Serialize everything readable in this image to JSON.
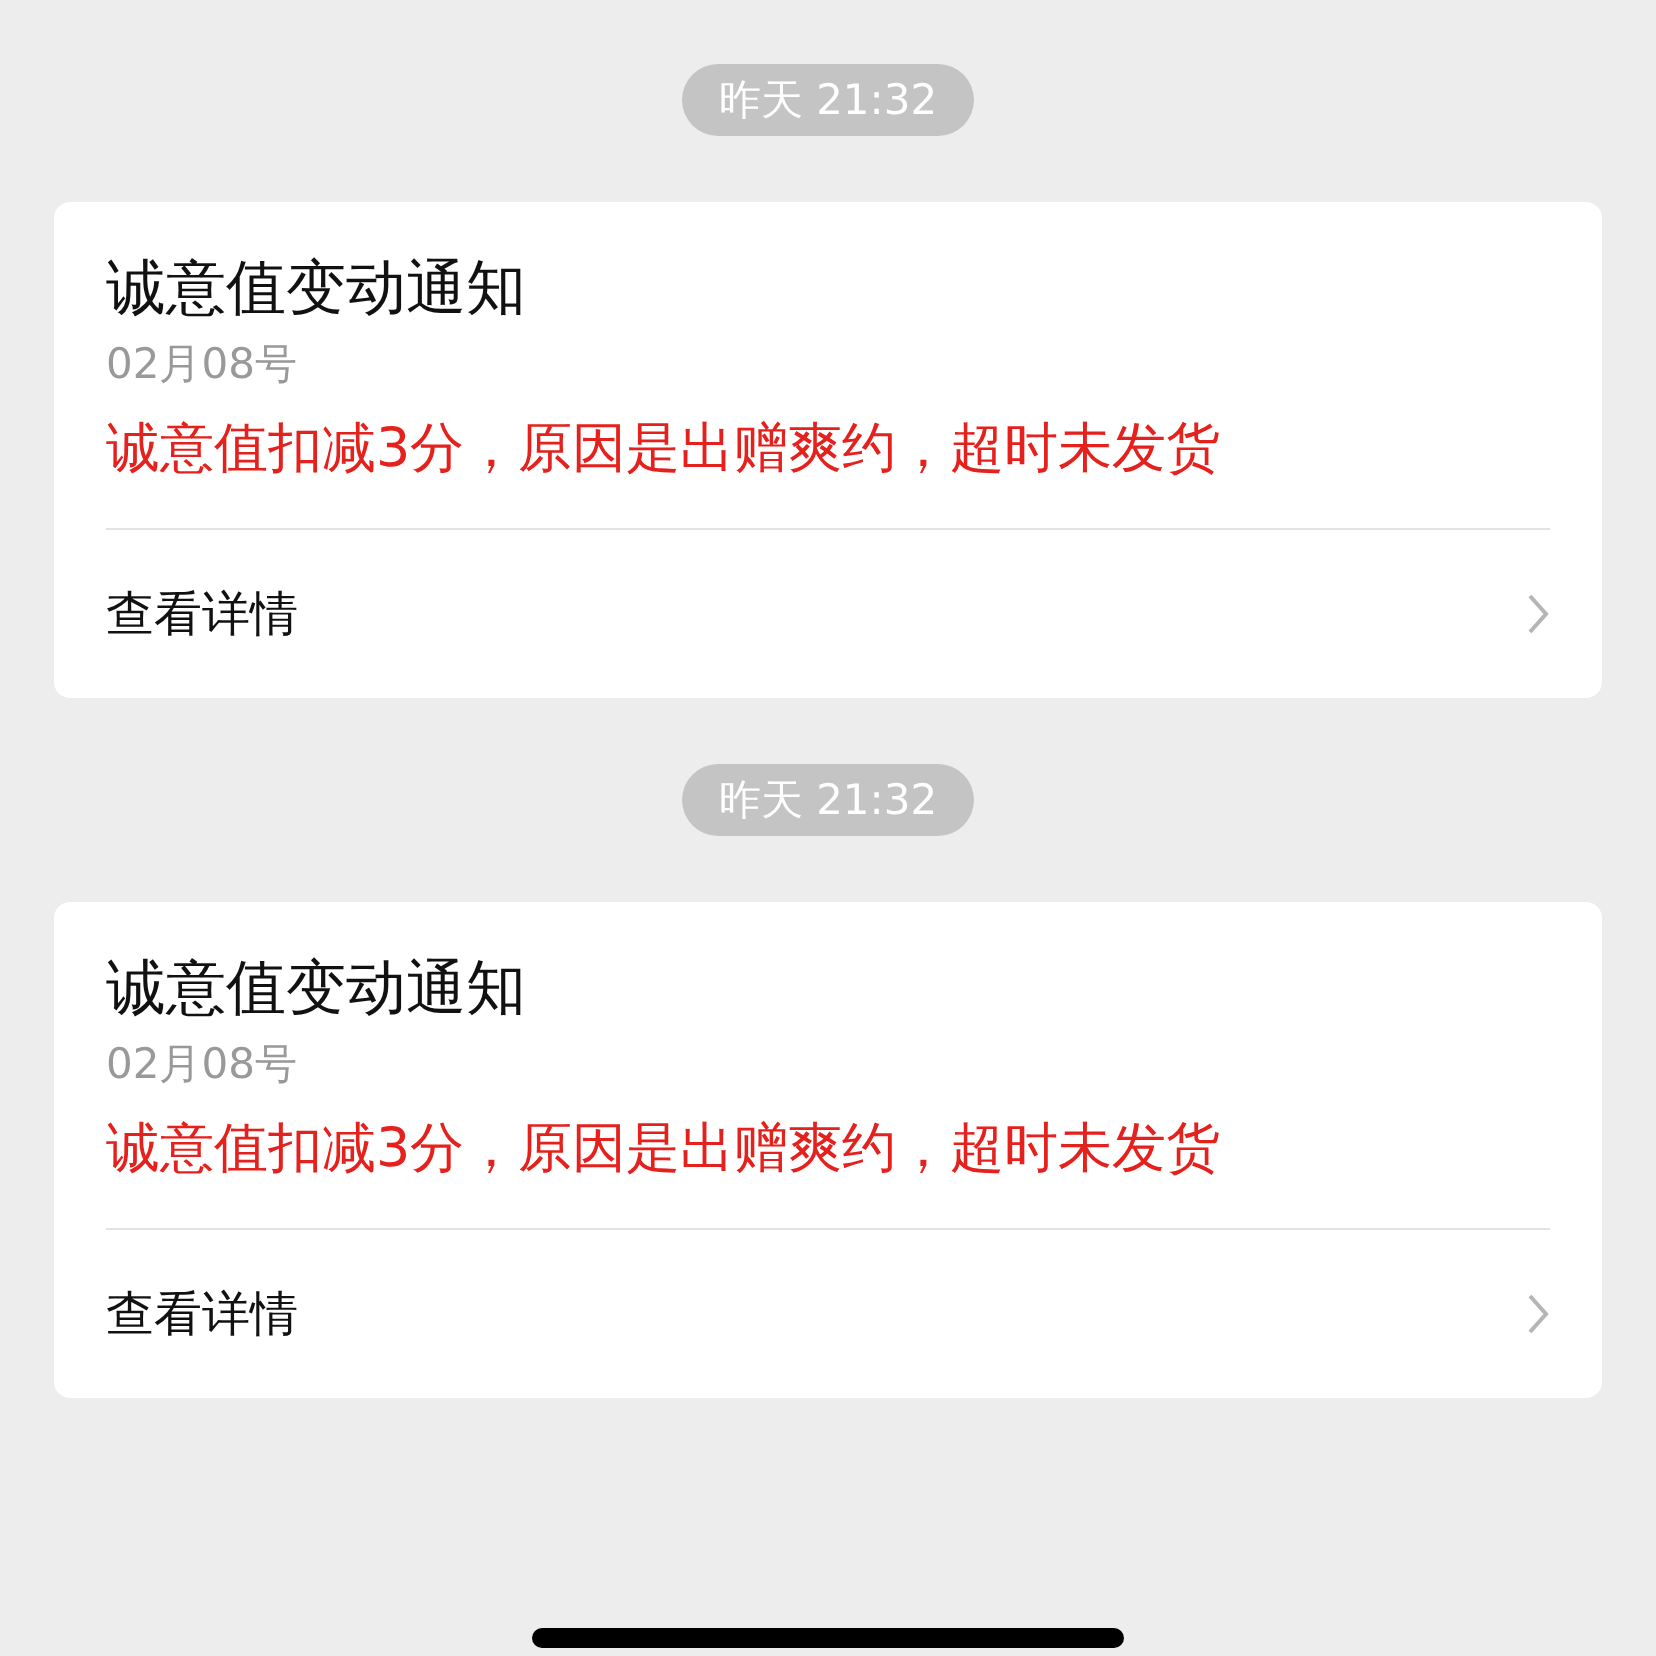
{
  "messages": [
    {
      "time": "昨天 21:32",
      "title": "诚意值变动通知",
      "date": "02月08号",
      "content": "诚意值扣减3分，原因是出赠爽约，超时未发货",
      "action": "查看详情"
    },
    {
      "time": "昨天 21:32",
      "title": "诚意值变动通知",
      "date": "02月08号",
      "content": "诚意值扣减3分，原因是出赠爽约，超时未发货",
      "action": "查看详情"
    }
  ]
}
